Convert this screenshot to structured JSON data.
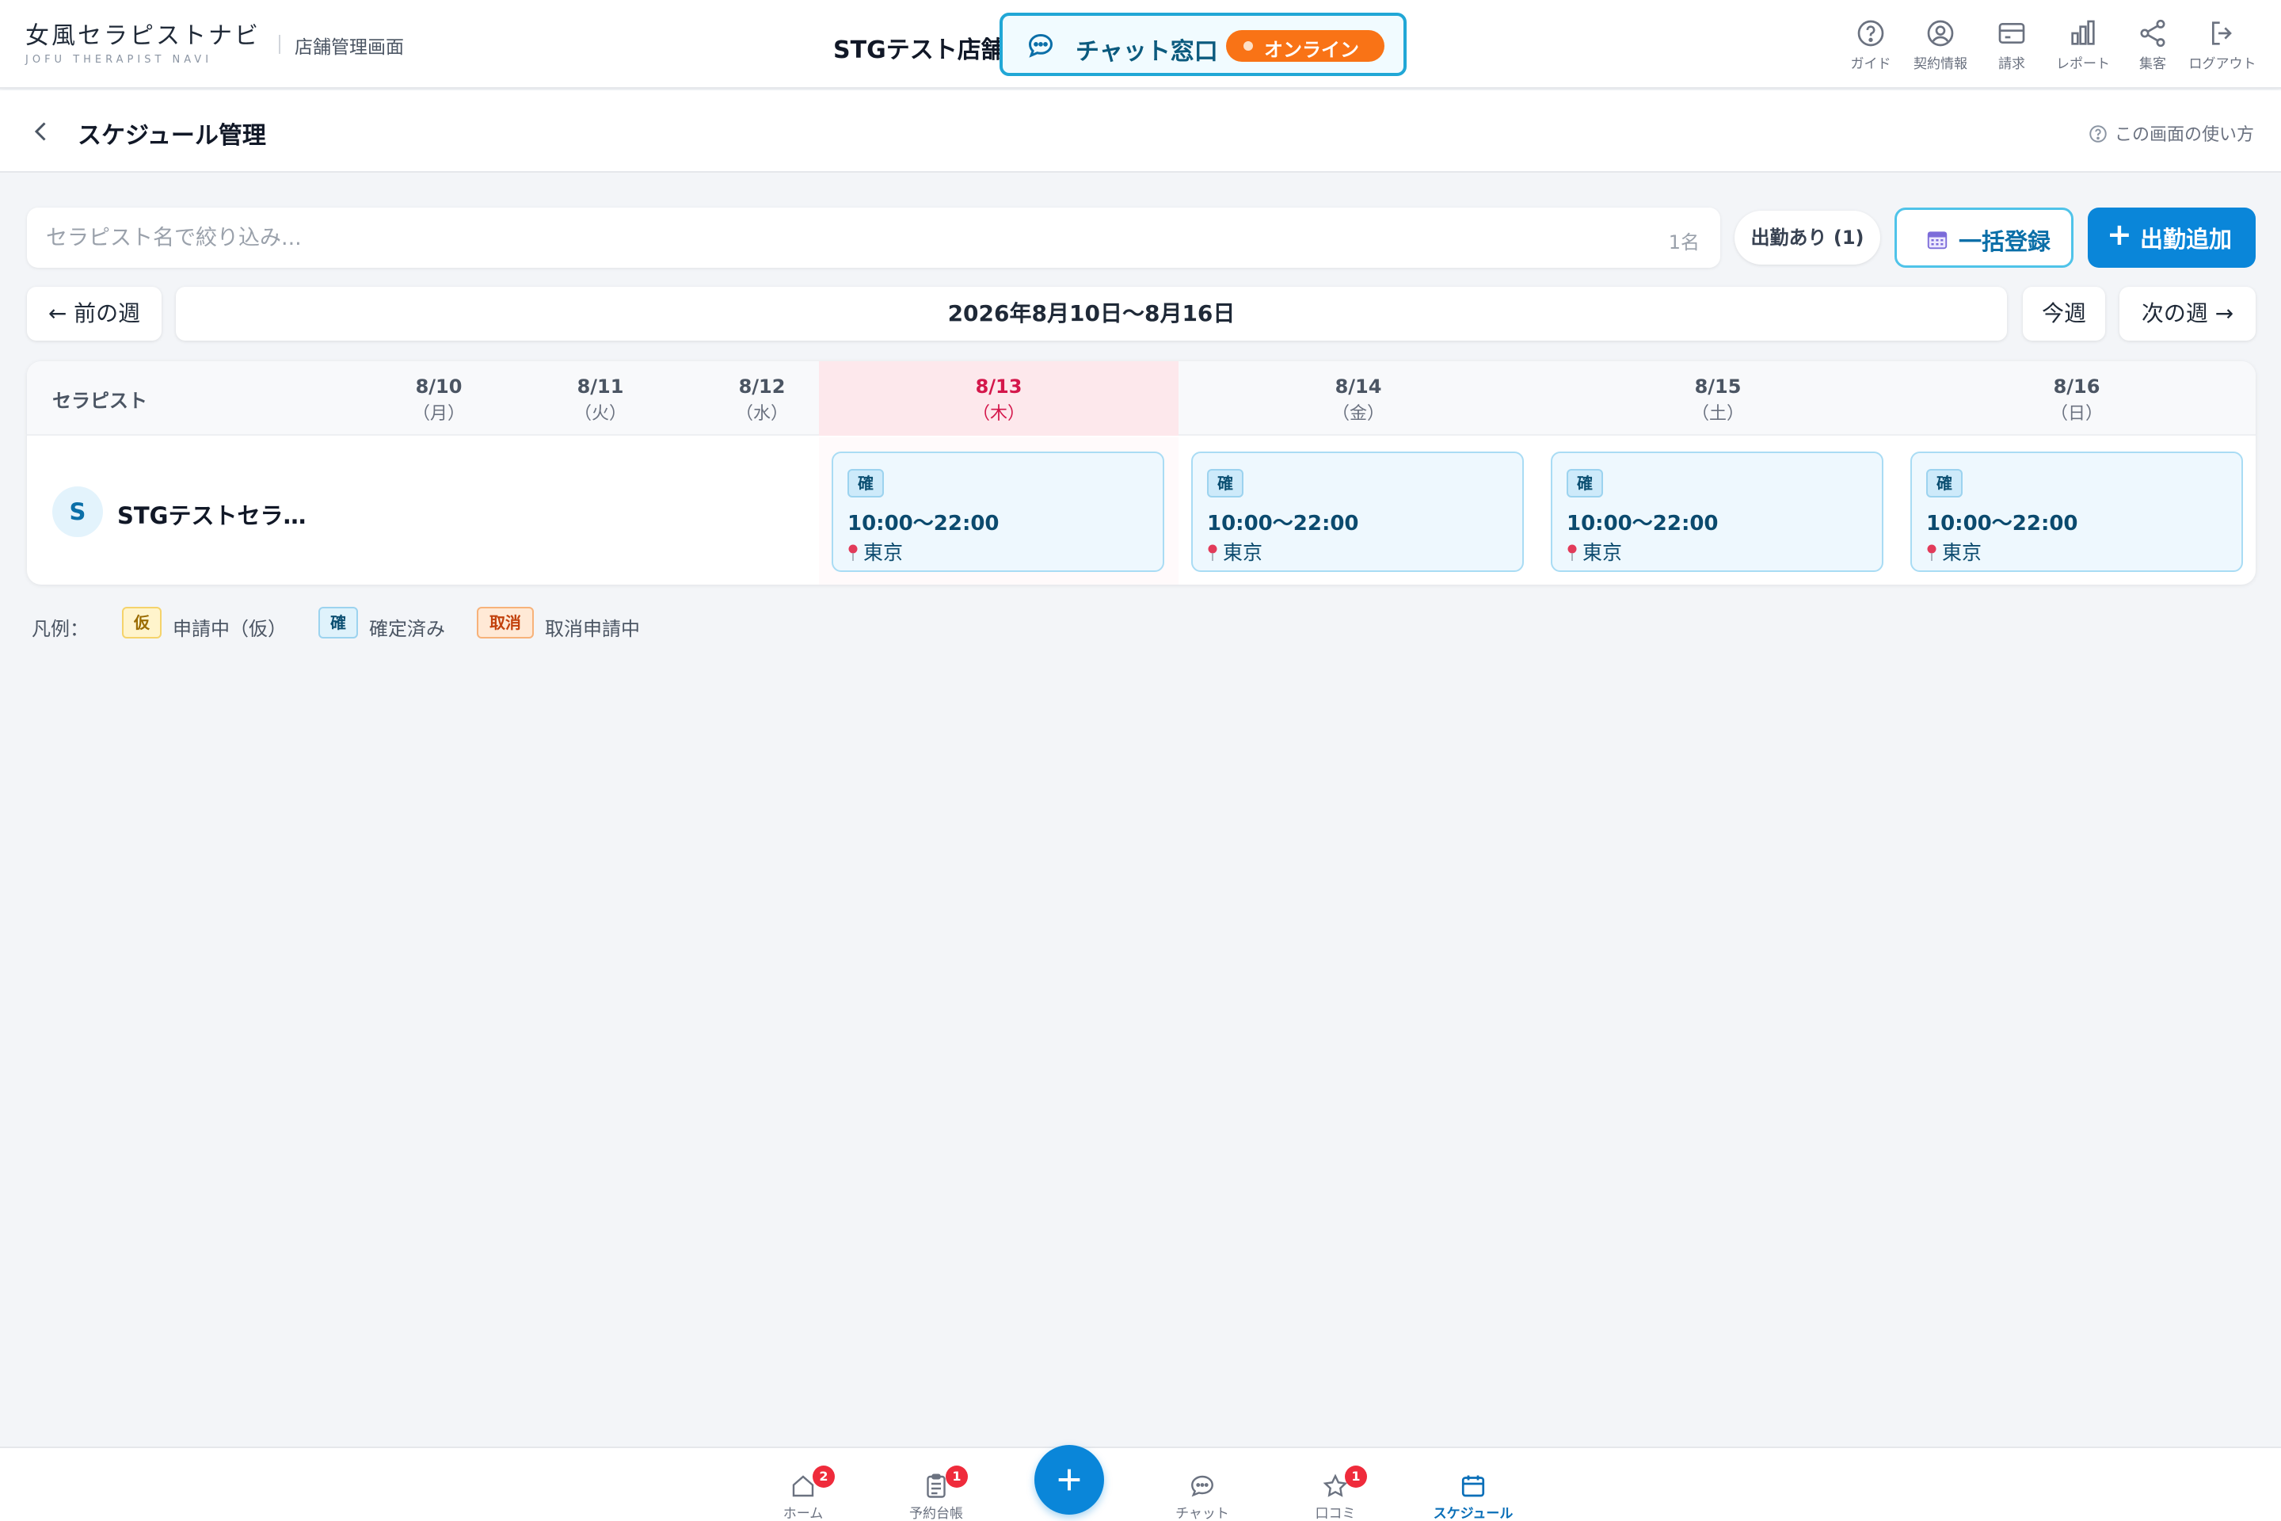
{
  "header": {
    "logo_main": "女風セラピストナビ",
    "logo_sub": "JOFU THERAPIST NAVI",
    "store_screen_label": "店舗管理画面",
    "store_name": "STGテスト店舗",
    "chat_label": "チャット窓口",
    "online_label": "オンライン",
    "nav": [
      {
        "label": "ガイド",
        "icon": "question-circle-icon"
      },
      {
        "label": "契約情報",
        "icon": "user-circle-icon"
      },
      {
        "label": "請求",
        "icon": "credit-card-icon"
      },
      {
        "label": "レポート",
        "icon": "bar-chart-icon"
      },
      {
        "label": "集客",
        "icon": "share-icon"
      },
      {
        "label": "ログアウト",
        "icon": "logout-icon"
      }
    ]
  },
  "subheader": {
    "title": "スケジュール管理",
    "help": "この画面の使い方"
  },
  "filters": {
    "search_placeholder": "セラピスト名で絞り込み...",
    "count": "1名",
    "filter_button": "出勤あり (1)",
    "bulk_button": "一括登録",
    "add_button": "出勤追加"
  },
  "week": {
    "prev": "← 前の週",
    "range": "2026年8月10日〜8月16日",
    "today": "今週",
    "next": "次の週 →"
  },
  "table": {
    "name_header": "セラピスト",
    "days": [
      {
        "date": "8/10",
        "weekday": "（月）",
        "today": false
      },
      {
        "date": "8/11",
        "weekday": "（火）",
        "today": false
      },
      {
        "date": "8/12",
        "weekday": "（水）",
        "today": false
      },
      {
        "date": "8/13",
        "weekday": "（木）",
        "today": true
      },
      {
        "date": "8/14",
        "weekday": "（金）",
        "today": false
      },
      {
        "date": "8/15",
        "weekday": "（土）",
        "today": false
      },
      {
        "date": "8/16",
        "weekday": "（日）",
        "today": false
      }
    ],
    "rows": [
      {
        "avatar": "S",
        "name": "STGテストセラ…",
        "shifts": [
          {
            "day": "8/13",
            "badge": "確",
            "time": "10:00〜22:00",
            "location": "東京"
          },
          {
            "day": "8/14",
            "badge": "確",
            "time": "10:00〜22:00",
            "location": "東京"
          },
          {
            "day": "8/15",
            "badge": "確",
            "time": "10:00〜22:00",
            "location": "東京"
          },
          {
            "day": "8/16",
            "badge": "確",
            "time": "10:00〜22:00",
            "location": "東京"
          }
        ]
      }
    ]
  },
  "legend": {
    "title": "凡例：",
    "items": [
      {
        "badge": "仮",
        "label": "申請中（仮）",
        "color": "#f5b700"
      },
      {
        "badge": "確",
        "label": "確定済み",
        "color": "#21a7d6"
      },
      {
        "badge": "取消",
        "label": "取消申請中",
        "color": "#f97316"
      }
    ]
  },
  "bottom_nav": {
    "items": [
      {
        "label": "ホーム",
        "icon": "home-icon",
        "badge": "2"
      },
      {
        "label": "予約台帳",
        "icon": "clipboard-icon",
        "badge": "1"
      },
      {
        "label": "チャット",
        "icon": "chat-icon",
        "badge": ""
      },
      {
        "label": "口コミ",
        "icon": "star-icon",
        "badge": "1"
      },
      {
        "label": "スケジュール",
        "icon": "calendar-icon",
        "badge": ""
      }
    ],
    "active": "スケジュール"
  },
  "colors": {
    "accent": "#0a86d9",
    "online": "#f97316",
    "today": "#d4174b",
    "confirmed_bg": "#eef8fe"
  }
}
